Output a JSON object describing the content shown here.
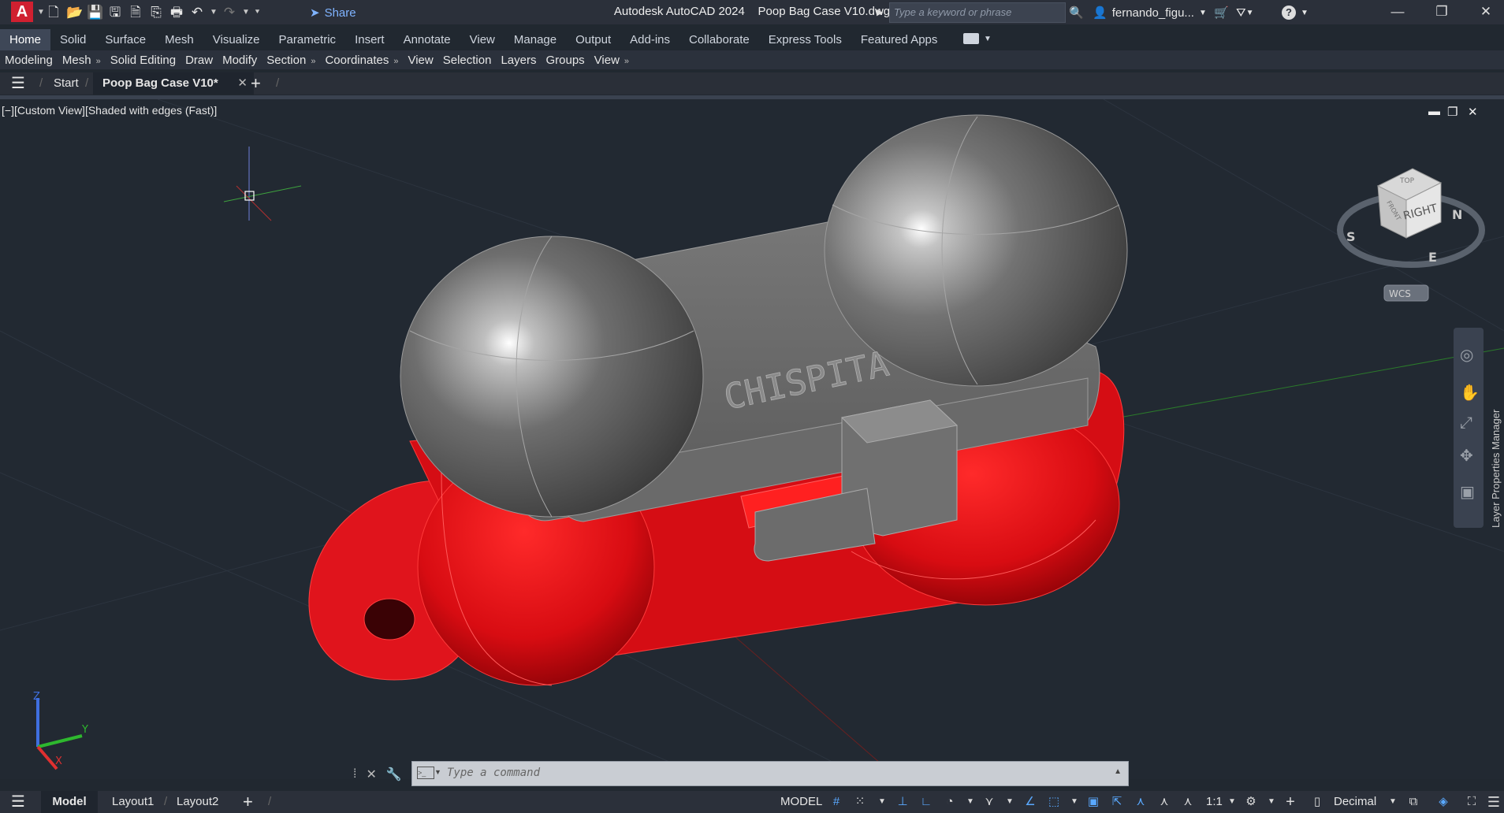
{
  "app": {
    "logo_letter": "A",
    "title": "Autodesk AutoCAD 2024",
    "document": "Poop Bag Case V10.dwg",
    "share_label": "Share",
    "search_placeholder": "Type a keyword or phrase",
    "user": "fernando_figu..."
  },
  "ribbon": {
    "tabs": [
      "Home",
      "Solid",
      "Surface",
      "Mesh",
      "Visualize",
      "Parametric",
      "Insert",
      "Annotate",
      "View",
      "Manage",
      "Output",
      "Add-ins",
      "Collaborate",
      "Express Tools",
      "Featured Apps"
    ],
    "active_tab": "Home",
    "panels": [
      {
        "label": "Modeling",
        "arrow": ""
      },
      {
        "label": "Mesh",
        "arrow": "»"
      },
      {
        "label": "Solid Editing",
        "arrow": ""
      },
      {
        "label": "Draw",
        "arrow": ""
      },
      {
        "label": "Modify",
        "arrow": ""
      },
      {
        "label": "Section",
        "arrow": "»"
      },
      {
        "label": "Coordinates",
        "arrow": "»"
      },
      {
        "label": "View",
        "arrow": ""
      },
      {
        "label": "Selection",
        "arrow": ""
      },
      {
        "label": "Layers",
        "arrow": ""
      },
      {
        "label": "Groups",
        "arrow": ""
      },
      {
        "label": "View",
        "arrow": "»"
      }
    ]
  },
  "file_tabs": {
    "start": "Start",
    "active": "Poop Bag Case V10*"
  },
  "viewport": {
    "label": "[−][Custom View][Shaded with edges (Fast)]",
    "engraving": "CHISPITA",
    "viewcube_face": "RIGHT",
    "viewcube_top": "TOP",
    "viewcube_front": "FRONT",
    "compass": {
      "n": "N",
      "s": "S",
      "e": "E"
    },
    "wcs": "WCS",
    "axis_labels": {
      "x": "X",
      "y": "Y",
      "z": "Z"
    }
  },
  "command": {
    "placeholder": "Type a command"
  },
  "side_panel": {
    "title": "Layer Properties Manager"
  },
  "status": {
    "tabs": {
      "model": "Model",
      "layout1": "Layout1",
      "layout2": "Layout2"
    },
    "model_label": "MODEL",
    "scale": "1:1",
    "units": "Decimal"
  },
  "colors": {
    "accent": "#5aa9ff",
    "viewport_bg": "#222932",
    "solid_red": "#e0141c",
    "solid_gray": "#7d7d7d"
  }
}
